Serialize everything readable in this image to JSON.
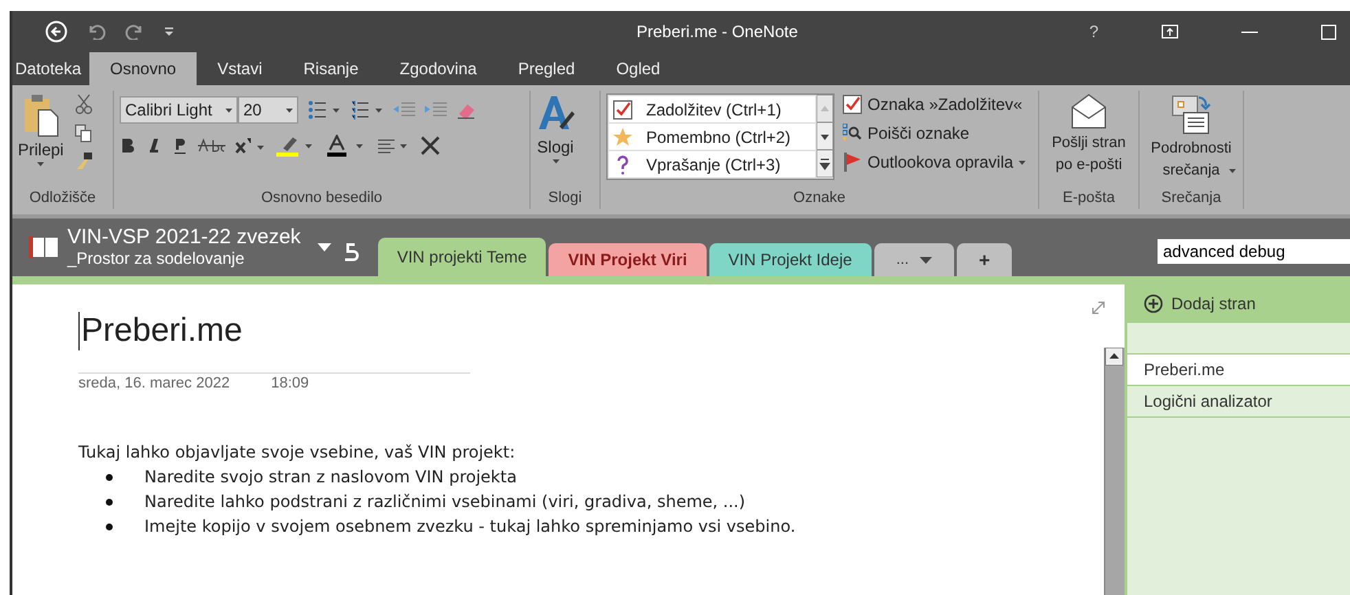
{
  "title_bar": {
    "title": "Preberi.me - OneNote",
    "help": "?"
  },
  "ribbon_tabs": [
    {
      "label": "Datoteka",
      "selected": false,
      "kind": "file"
    },
    {
      "label": "Osnovno",
      "selected": true,
      "kind": "tab"
    },
    {
      "label": "Vstavi",
      "selected": false,
      "kind": "tab"
    },
    {
      "label": "Risanje",
      "selected": false,
      "kind": "tab"
    },
    {
      "label": "Zgodovina",
      "selected": false,
      "kind": "tab"
    },
    {
      "label": "Pregled",
      "selected": false,
      "kind": "tab"
    },
    {
      "label": "Ogled",
      "selected": false,
      "kind": "tab"
    }
  ],
  "ribbon": {
    "clipboard": {
      "paste": "Prilepi",
      "label": "Odložišče"
    },
    "basic_text": {
      "font": "Calibri Light",
      "size": "20",
      "label": "Osnovno besedilo"
    },
    "styles": {
      "button": "Slogi",
      "label": "Slogi"
    },
    "tags": {
      "gallery": [
        {
          "label": "Zadolžitev (Ctrl+1)",
          "kind": "check"
        },
        {
          "label": "Pomembno (Ctrl+2)",
          "kind": "star"
        },
        {
          "label": "Vprašanje (Ctrl+3)",
          "kind": "question"
        }
      ],
      "buttons": [
        {
          "label": "Oznaka »Zadolžitev«",
          "kind": "check"
        },
        {
          "label": "Poišči oznake",
          "kind": "find"
        },
        {
          "label": "Outlookova opravila",
          "kind": "flag"
        }
      ],
      "label": "Oznake"
    },
    "email": {
      "button": "Pošlji stran po e-pošti",
      "label": "E-pošta"
    },
    "meetings": {
      "button": "Podrobnosti srečanja",
      "label": "Srečanja"
    }
  },
  "notebook": {
    "name": "VIN-VSP 2021-22 zvezek",
    "section_group": "_Prostor za sodelovanje"
  },
  "section_tabs": [
    {
      "label": "VIN projekti Teme",
      "color": "#a9d18e",
      "selected": true
    },
    {
      "label": "VIN Projekt Viri",
      "color": "#f4a3a3",
      "selected": false
    },
    {
      "label": "VIN Projekt Ideje",
      "color": "#7fd5c6",
      "selected": false
    }
  ],
  "more_tabs": "...",
  "add_tab": "+",
  "search": {
    "value": "advanced debug"
  },
  "page": {
    "title": "Preberi.me",
    "date": "sreda, 16. marec 2022",
    "time": "18:09",
    "intro": "Tukaj lahko objavljate svoje vsebine, vaš VIN projekt:",
    "bullets": [
      "Naredite svojo stran z naslovom VIN projekta",
      "Naredite lahko podstrani z različnimi vsebinami (viri, gradiva, sheme, ...)",
      "Imejte kopijo v svojem osebnem zvezku - tukaj lahko spreminjamo vsi vsebino."
    ]
  },
  "page_list": {
    "add": "Dodaj stran",
    "pages": [
      {
        "title": "Preberi.me",
        "selected": true
      },
      {
        "title": "Logični analizator",
        "selected": false
      }
    ]
  }
}
